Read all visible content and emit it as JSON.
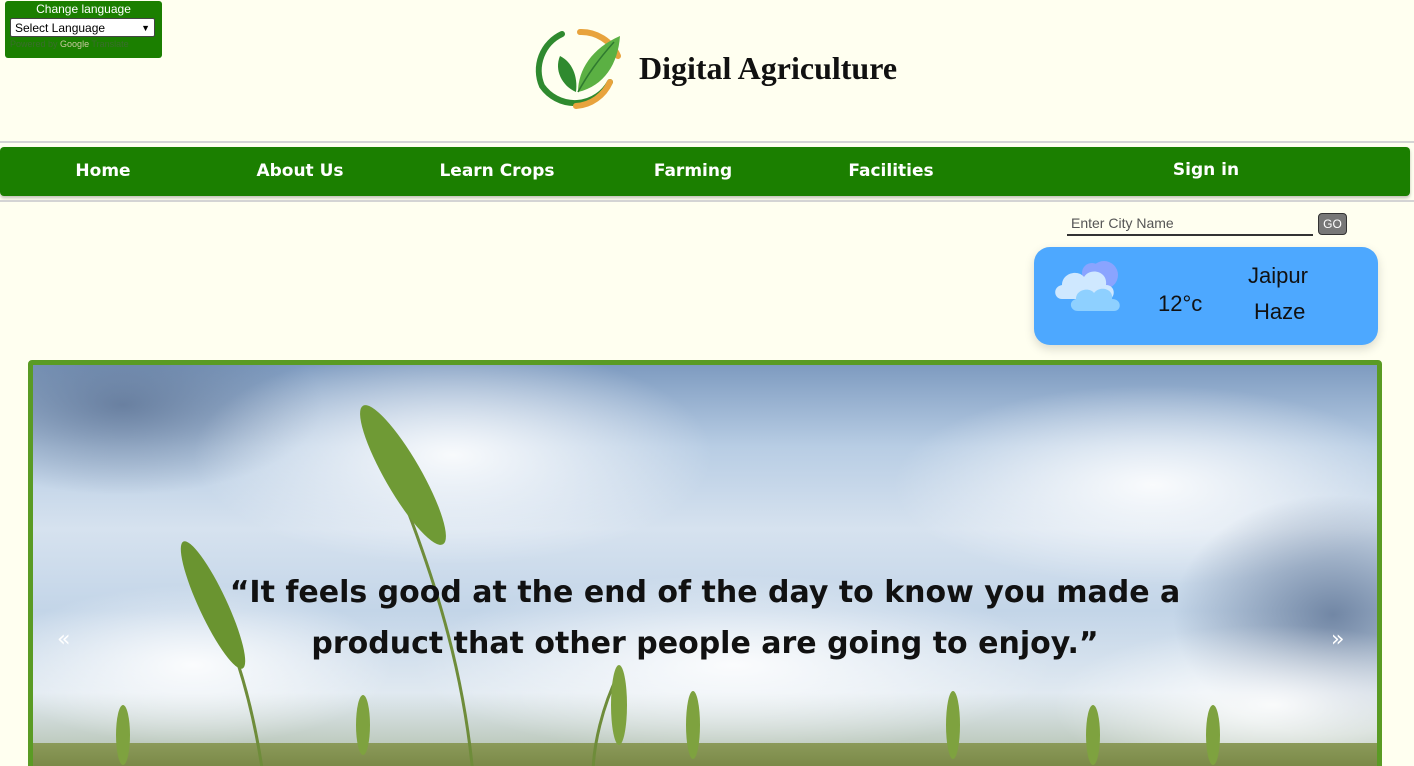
{
  "language_widget": {
    "title": "Change language",
    "selected": "Select Language",
    "powered_by": "Powered by",
    "google": "Google",
    "translate": "Translate"
  },
  "header": {
    "site_title": "Digital Agriculture",
    "logo_icon": "leaf-logo-icon"
  },
  "nav": {
    "items": [
      {
        "label": "Home"
      },
      {
        "label": "About Us"
      },
      {
        "label": "Learn Crops"
      },
      {
        "label": "Farming"
      },
      {
        "label": "Facilities"
      },
      {
        "label": "Sign in"
      }
    ]
  },
  "weather_search": {
    "placeholder": "Enter City Name",
    "button_label": "GO"
  },
  "weather": {
    "icon": "cloud-icon",
    "temperature": "12°c",
    "city": "Jaipur",
    "condition": "Haze"
  },
  "hero": {
    "quote": "“It feels good at the end of the day to know you made a product that other people are going to enjoy.”",
    "prev_label": "«",
    "next_label": "»"
  },
  "colors": {
    "nav_green": "#1b7f00",
    "background": "#fffff0",
    "weather_blue": "#4da8ff",
    "hero_border": "#5a9b24"
  }
}
